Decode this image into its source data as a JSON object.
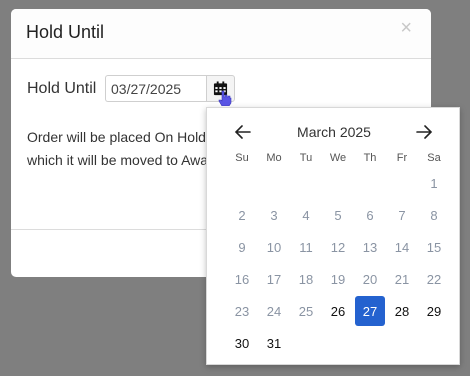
{
  "modal": {
    "title": "Hold Until",
    "close_glyph": "×",
    "field_label": "Hold Until",
    "date_value": "03/27/2025",
    "description": "Order will be placed On Hold until the selected date, after which it will be moved to Awaiting Fulfillment."
  },
  "icons": {
    "calendar": "calendar-icon",
    "cursor": "pointer-hand-icon",
    "prev": "arrow-left-icon",
    "next": "arrow-right-icon"
  },
  "colors": {
    "selected_day": "#2462cf",
    "overlay": "#7f7f7f"
  },
  "datepicker": {
    "month_label": "March 2025",
    "weekdays": [
      "Su",
      "Mo",
      "Tu",
      "We",
      "Th",
      "Fr",
      "Sa"
    ],
    "weeks": [
      [
        "",
        "",
        "",
        "",
        "",
        "",
        "1"
      ],
      [
        "2",
        "3",
        "4",
        "5",
        "6",
        "7",
        "8"
      ],
      [
        "9",
        "10",
        "11",
        "12",
        "13",
        "14",
        "15"
      ],
      [
        "16",
        "17",
        "18",
        "19",
        "20",
        "21",
        "22"
      ],
      [
        "23",
        "24",
        "25",
        "26",
        "27",
        "28",
        "29"
      ],
      [
        "30",
        "31",
        "",
        "",
        "",
        "",
        ""
      ]
    ],
    "selected_day": "27",
    "first_selectable_day": 26
  }
}
